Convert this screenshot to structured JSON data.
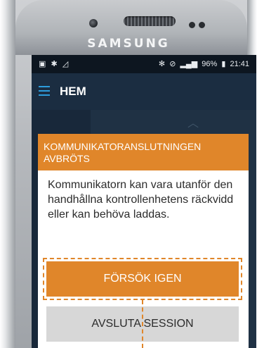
{
  "device": {
    "brand": "SAMSUNG"
  },
  "status_bar": {
    "left_icons": [
      "image-icon",
      "accessibility-icon",
      "signal-icon"
    ],
    "right_icons": [
      "bluetooth-icon",
      "mute-icon",
      "cellular-icon"
    ],
    "battery": "96%",
    "time": "21:41"
  },
  "app_bar": {
    "title": "HEM",
    "menu_icon": "hamburger-menu-icon",
    "accent_color": "#2d9cdb"
  },
  "dialog": {
    "title": "KOMMUNIKATORANSLUTNINGEN AVBRÖTS",
    "message": "Kommunikatorn kan vara utanför den handhållna kontrollenhetens räckvidd eller kan behöva laddas.",
    "retry_label": "FÖRSÖK IGEN",
    "end_label": "AVSLUTA SESSION",
    "header_color": "#e0862a",
    "highlight_color": "#e0862a"
  }
}
